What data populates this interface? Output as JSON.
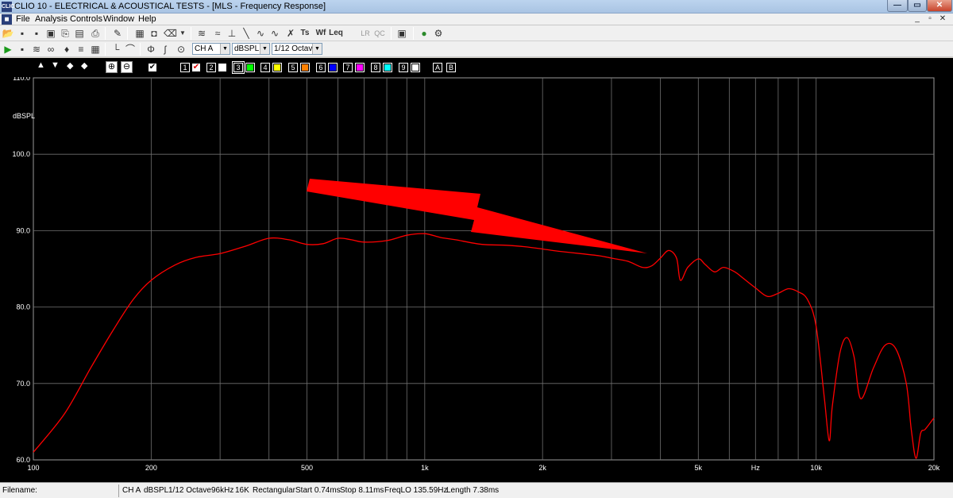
{
  "window": {
    "app_icon": "CLIO",
    "title": "CLIO 10 - ELECTRICAL & ACOUSTICAL TESTS - [MLS - Frequency Response]"
  },
  "menu": [
    "File",
    "Analysis",
    "Controls",
    "Window",
    "Help"
  ],
  "toolbar1": {
    "icons": [
      "open-icon",
      "save-icon",
      "save-as-icon",
      "export-icon",
      "copy-icon",
      "print-icon",
      "notes-icon",
      "setup-icon",
      "camera-icon",
      "eraser-icon",
      "dropdown-icon",
      "sinusoidal-icon",
      "multimeter-icon",
      "impulse-icon",
      "step-icon",
      "sine-icon",
      "thd-icon",
      "ts-icon",
      "wf-icon",
      "leq-icon",
      "lr-icon",
      "qc-icon",
      "monitor-icon",
      "help-icon",
      "settings-icon"
    ],
    "labels": {
      "ts": "Ts",
      "wf": "Wf",
      "leq": "Leq",
      "lr": "LR",
      "qc": "QC"
    }
  },
  "toolbar2": {
    "icons": [
      "play-icon",
      "disk-icon",
      "generator-icon",
      "loop-icon",
      "mic-icon",
      "spectrum-icon",
      "window-icon",
      "impulse-icon",
      "smooth-icon",
      "phase-icon",
      "group-delay-icon",
      "zoom-icon"
    ],
    "channel": "CH A",
    "unit": "dBSPL",
    "smoothing": "1/12 Octave"
  },
  "chart_header": {
    "arrows": [
      "▲",
      "▼",
      "◆",
      "◆"
    ],
    "overlays": [
      {
        "num": "1",
        "checked": true
      },
      {
        "num": "2",
        "checked": false
      },
      {
        "num": "3",
        "checked": false,
        "color": "#00ff00"
      },
      {
        "num": "4",
        "checked": false,
        "color": "#ffff00"
      },
      {
        "num": "5",
        "checked": false,
        "color": "#ff8000"
      },
      {
        "num": "6",
        "checked": false,
        "color": "#0000ff"
      },
      {
        "num": "7",
        "checked": false,
        "color": "#ff00ff"
      },
      {
        "num": "8",
        "checked": false,
        "color": "#00ffff"
      },
      {
        "num": "9",
        "checked": false,
        "color": "#ffffff"
      }
    ],
    "a_label": "A",
    "b_label": "B"
  },
  "chart_data": {
    "type": "line",
    "xscale": "log",
    "xlim": [
      100,
      20000
    ],
    "ylim": [
      60,
      110
    ],
    "ylabel": "dBSPL",
    "y_ticks": [
      "110.0",
      "100.0",
      "90.0",
      "80.0",
      "70.0",
      "60.0"
    ],
    "y_tick_values": [
      110,
      100,
      90,
      80,
      70,
      60
    ],
    "x_ticks": [
      "100",
      "200",
      "500",
      "1k",
      "2k",
      "5k",
      "Hz",
      "10k",
      "20k"
    ],
    "x_tick_values": [
      100,
      200,
      500,
      1000,
      2000,
      5000,
      7000,
      10000,
      20000
    ],
    "grid": true,
    "series": [
      {
        "color": "#ff0000",
        "x": [
          100,
          120,
          140,
          160,
          180,
          200,
          230,
          260,
          300,
          350,
          400,
          450,
          500,
          550,
          600,
          650,
          700,
          800,
          900,
          1000,
          1100,
          1200,
          1400,
          1600,
          1800,
          2000,
          2200,
          2500,
          2800,
          3000,
          3300,
          3600,
          3800,
          4000,
          4200,
          4400,
          4500,
          4700,
          5000,
          5200,
          5500,
          5800,
          6200,
          6500,
          7000,
          7500,
          8000,
          8500,
          9000,
          9500,
          10000,
          10500,
          10800,
          11000,
          11500,
          12000,
          12500,
          13000,
          14000,
          15000,
          16000,
          17000,
          17500,
          18000,
          18500,
          19000,
          20000
        ],
        "y": [
          61,
          66,
          72,
          77,
          81,
          83.5,
          85.5,
          86.5,
          87,
          88,
          89,
          88.8,
          88.2,
          88.3,
          89,
          88.8,
          88.5,
          88.7,
          89.4,
          89.6,
          89.1,
          88.8,
          88.2,
          88.1,
          87.9,
          87.6,
          87.3,
          87,
          86.7,
          86.4,
          86,
          85.2,
          85.4,
          86.4,
          87.4,
          86.4,
          83.5,
          85.2,
          86.3,
          85.6,
          84.6,
          85.2,
          84.6,
          83.8,
          82.5,
          81.4,
          81.8,
          82.4,
          82,
          81,
          77.5,
          68,
          62.5,
          67,
          74,
          76,
          73.5,
          68,
          72,
          75,
          74.5,
          70,
          64,
          60.2,
          63.5,
          64,
          65.5
        ]
      }
    ],
    "annotation": {
      "type": "arrow",
      "color": "#ff0000"
    }
  },
  "status": {
    "filename_label": "Filename:",
    "filename": "",
    "fields": [
      "CH A",
      "dBSPL",
      "1/12 Octave",
      "96kHz",
      "16K",
      "Rectangular",
      "Start 0.74ms",
      "Stop 8.11ms",
      "FreqLO 135.59Hz",
      "Length 7.38ms"
    ]
  }
}
